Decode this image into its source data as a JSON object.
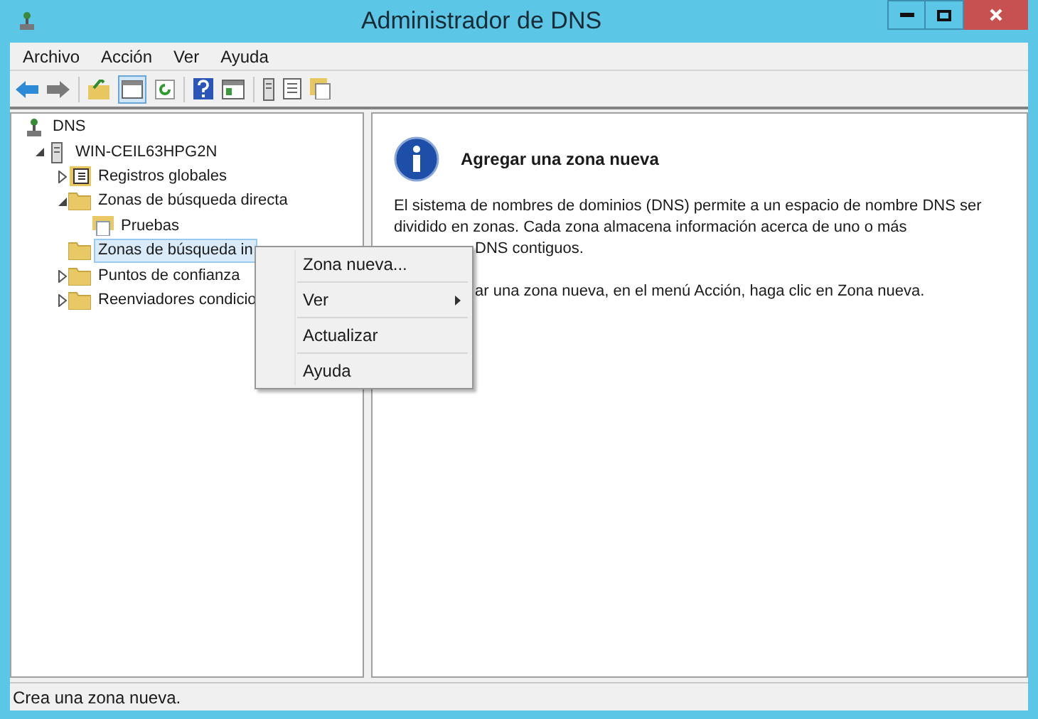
{
  "window": {
    "title": "Administrador de DNS"
  },
  "menu_bar": [
    "Archivo",
    "Acción",
    "Ver",
    "Ayuda"
  ],
  "tree": [
    {
      "label": "DNS",
      "kind": "dns",
      "selected": false,
      "children": [
        {
          "label": "WIN-CEIL63HPG2N",
          "kind": "server",
          "expanded": true,
          "selected": false,
          "children": [
            {
              "label": "Registros globales",
              "kind": "records",
              "expanded": false,
              "selected": false
            },
            {
              "label": "Zonas de búsqueda directa",
              "kind": "folder",
              "expanded": true,
              "selected": false,
              "children": [
                {
                  "label": "Pruebas",
                  "kind": "zone",
                  "selected": false
                }
              ]
            },
            {
              "label": "Zonas de búsqueda in",
              "kind": "folder",
              "selected": true
            },
            {
              "label": "Puntos de confianza",
              "kind": "folder",
              "expanded": false,
              "selected": false
            },
            {
              "label": "Reenviadores condicio",
              "kind": "folder",
              "expanded": false,
              "selected": false
            }
          ]
        }
      ]
    }
  ],
  "content": {
    "heading": "Agregar una zona nueva",
    "paragraph": "El sistema de nombres de dominios (DNS) permite a un espacio de nombre DNS ser dividido en zonas. Cada zona almacena información acerca de uno o más",
    "line_3": "DNS contiguos.",
    "line_4": "ar una zona nueva, en el menú Acción, haga clic en Zona nueva."
  },
  "context_menu": [
    {
      "label": "Zona nueva...",
      "submenu": false
    },
    {
      "label": "Ver",
      "submenu": true
    },
    {
      "label": "Actualizar",
      "submenu": false
    },
    {
      "label": "Ayuda",
      "submenu": false
    }
  ],
  "status_bar": "Crea una zona nueva."
}
